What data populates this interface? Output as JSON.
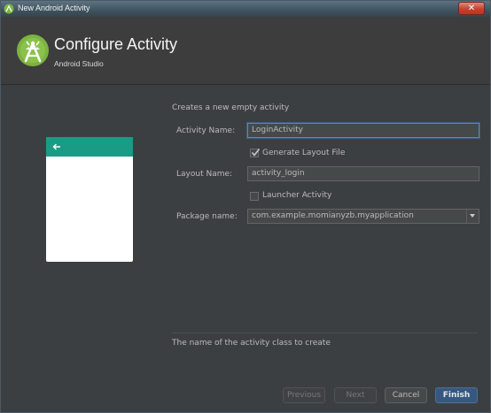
{
  "window": {
    "title": "New Android Activity",
    "close_label": "✕"
  },
  "header": {
    "title": "Configure Activity",
    "subtitle": "Android Studio"
  },
  "form": {
    "description": "Creates a new empty activity",
    "activity_name_label": "Activity Name:",
    "activity_name_value": "LoginActivity",
    "generate_layout_label": "Generate Layout File",
    "generate_layout_checked": true,
    "layout_name_label": "Layout Name:",
    "layout_name_value": "activity_login",
    "launcher_activity_label": "Launcher Activity",
    "launcher_activity_checked": false,
    "package_name_label": "Package name:",
    "package_name_value": "com.example.momianyzb.myapplication",
    "hint": "The name of the activity class to create"
  },
  "footer": {
    "previous_label": "Previous",
    "next_label": "Next",
    "cancel_label": "Cancel",
    "finish_label": "Finish"
  },
  "colors": {
    "accent": "#1a9b86",
    "primary_button": "#365880",
    "background": "#3c3f41"
  }
}
